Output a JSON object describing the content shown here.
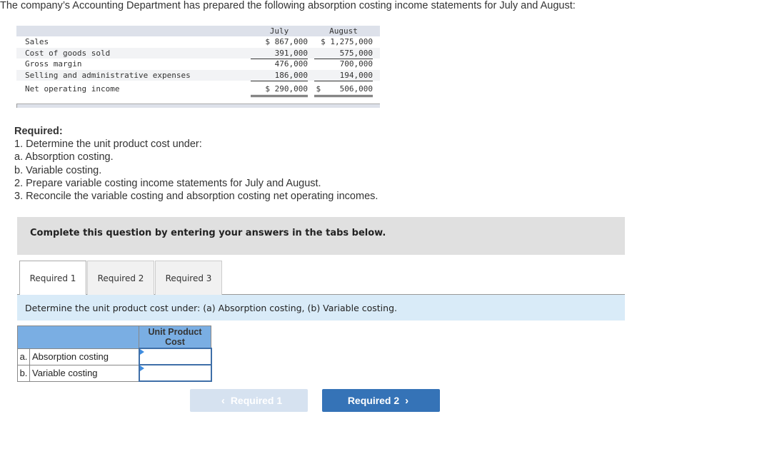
{
  "intro": "The company’s Accounting Department has prepared the following absorption costing income statements for July and August:",
  "statement": {
    "columns": [
      "July",
      "August"
    ],
    "rows": [
      {
        "label": "Sales",
        "july": "$ 867,000",
        "august": "$ 1,275,000"
      },
      {
        "label": "Cost of goods sold",
        "july": "391,000",
        "august": "575,000"
      },
      {
        "label": "Gross margin",
        "july": "476,000",
        "august": "700,000"
      },
      {
        "label": "Selling and administrative expenses",
        "july": "186,000",
        "august": "194,000"
      },
      {
        "label": "Net operating income",
        "july": "$ 290,000",
        "august": "$    506,000"
      }
    ]
  },
  "required": {
    "title": "Required:",
    "items": [
      "1. Determine the unit product cost under:",
      "a. Absorption costing.",
      "b. Variable costing.",
      "2. Prepare variable costing income statements for July and August.",
      "3. Reconcile the variable costing and absorption costing net operating incomes."
    ]
  },
  "banner": "Complete this question by entering your answers in the tabs below.",
  "tabs": [
    {
      "label": "Required 1",
      "active": true
    },
    {
      "label": "Required 2",
      "active": false
    },
    {
      "label": "Required 3",
      "active": false
    }
  ],
  "instruction": "Determine the unit product cost under: (a) Absorption costing, (b) Variable costing.",
  "answer_table": {
    "header": "Unit Product Cost",
    "rows": [
      {
        "letter": "a.",
        "label": "Absorption costing",
        "value": ""
      },
      {
        "letter": "b.",
        "label": "Variable costing",
        "value": ""
      }
    ]
  },
  "nav": {
    "prev_label": "Required 1",
    "next_label": "Required 2",
    "prev_icon": "chevron-left-icon",
    "next_icon": "chevron-right-icon"
  }
}
